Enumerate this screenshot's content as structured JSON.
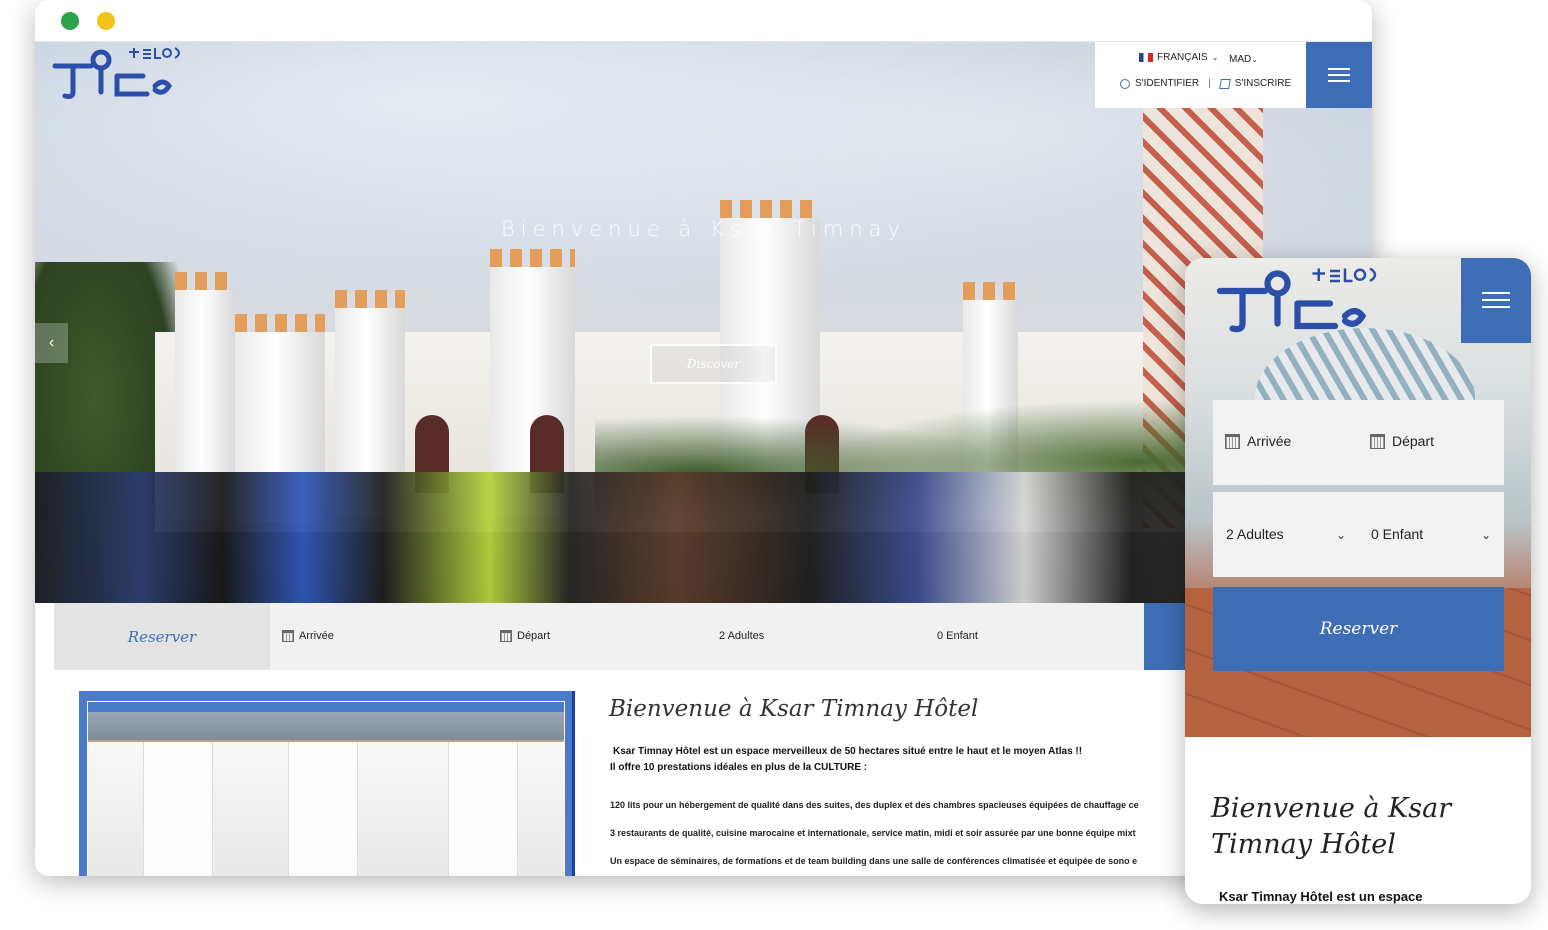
{
  "desktop": {
    "window_controls": [
      "green",
      "yellow"
    ],
    "header": {
      "logo_icon": "tifinagh-logo-icon",
      "language": "FRANÇAIS",
      "currency": "MAD",
      "login_label": "S'IDENTIFIER",
      "separator": "|",
      "signup_label": "S'INSCRIRE",
      "menu_icon": "hamburger-icon"
    },
    "hero": {
      "title": "Bienvenue à Ksar Timnay",
      "cta_label": "Discover",
      "prev_icon": "chevron-left-icon"
    },
    "booking": {
      "reserve_tab": "Reserver",
      "arrival_label": "Arrivée",
      "departure_label": "Départ",
      "adults_label": "2 Adultes",
      "children_label": "0 Enfant"
    },
    "content": {
      "heading": "Bienvenue à Ksar Timnay Hôtel",
      "intro_line1": "Ksar Timnay Hôtel est un espace merveilleux de 50 hectares situé entre le haut et le moyen Atlas !!",
      "intro_line2": "Il offre 10 prestations idéales en plus de la CULTURE :",
      "items": [
        "120 lits pour un hébergement de qualité dans des suites, des duplex et des chambres spacieuses équipées de chauffage ce",
        "3 restaurants de qualité, cuisine marocaine et internationale, service matin, midi et soir assurée par une bonne équipe mixt",
        "Un espace de séminaires, de formations et de team building dans une salle de conférences climatisée et équipée de sono e"
      ]
    }
  },
  "mobile": {
    "menu_icon": "hamburger-icon",
    "arrival_label": "Arrivée",
    "departure_label": "Départ",
    "adults_label": "2 Adultes",
    "children_label": "0 Enfant",
    "reserve_label": "Reserver",
    "heading": "Bienvenue à Ksar Timnay Hôtel",
    "intro": "Ksar Timnay Hôtel est un espace"
  },
  "colors": {
    "brand_blue": "#3d6db5",
    "dark_blue": "#1b3fb0",
    "booking_bg": "#f1f1f1"
  }
}
